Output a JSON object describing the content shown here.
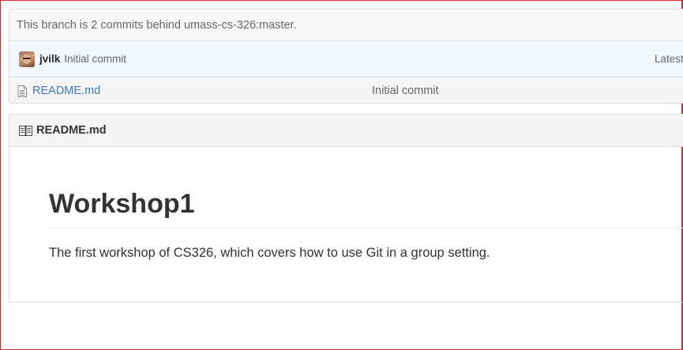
{
  "branch_bar": {
    "text": "This branch is 2 commits behind umass-cs-326:master."
  },
  "commit_tease": {
    "author": "jvilk",
    "message": "Initial commit",
    "latest_label": "Latest"
  },
  "files": [
    {
      "name": "README.md",
      "commit_message": "Initial commit",
      "icon": "file-text-icon"
    }
  ],
  "readme": {
    "header_label": "README.md",
    "header_icon": "book-icon",
    "title": "Workshop1",
    "description": "The first workshop of CS326, which covers how to use Git in a group setting."
  },
  "colors": {
    "link": "#4078c0",
    "commit_tease_bg": "#f1f8fe",
    "frame_border": "#d9262c"
  }
}
